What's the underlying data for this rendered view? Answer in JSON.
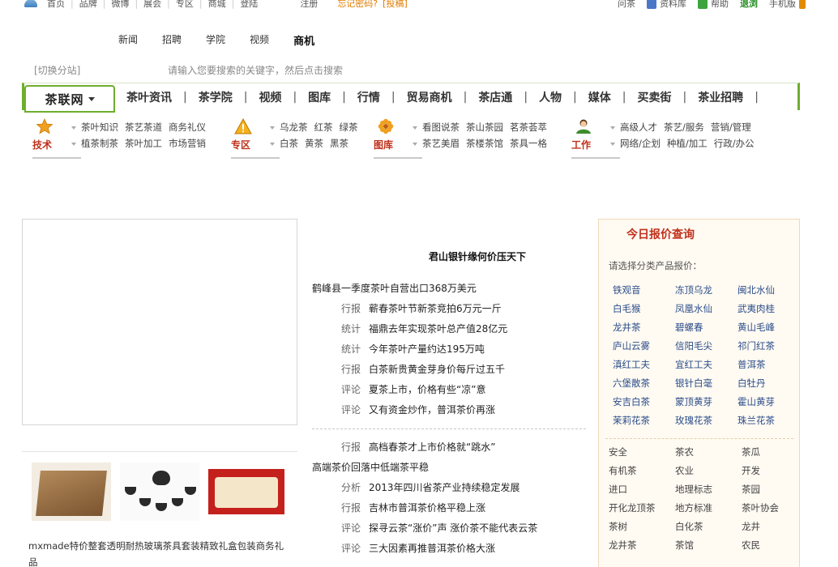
{
  "topbar": {
    "links": [
      "首页",
      "品牌",
      "微博",
      "展会",
      "专区",
      "商城",
      "登陆",
      "注册"
    ],
    "forgot": "忘记密码?",
    "submit": "[投稿]",
    "right": [
      "问茶",
      "资料库",
      "帮助",
      "退浏",
      "手机版"
    ]
  },
  "search": {
    "tabs": [
      "新闻",
      "招聘",
      "学院",
      "视频",
      "商机"
    ],
    "active_tab": "商机",
    "switch_site": "[切换分站]",
    "placeholder": "请输入您要搜索的关键字，然后点击搜索"
  },
  "mainnav": {
    "brand": "茶联网",
    "items": [
      "茶叶资讯",
      "茶学院",
      "视频",
      "图库",
      "行情",
      "贸易商机",
      "茶店通",
      "人物",
      "媒体",
      "买卖街",
      "茶业招聘"
    ]
  },
  "subnav": [
    {
      "label": "技术",
      "icon": "star-icon",
      "rows": [
        [
          "茶叶知识",
          "茶艺茶道",
          "商务礼仪"
        ],
        [
          "植茶制茶",
          "茶叶加工",
          "市场营销"
        ]
      ]
    },
    {
      "label": "专区",
      "icon": "warning-icon",
      "rows": [
        [
          "乌龙茶",
          "红茶",
          "绿茶"
        ],
        [
          "白茶",
          "黄茶",
          "黑茶"
        ]
      ]
    },
    {
      "label": "图库",
      "icon": "flower-icon",
      "rows": [
        [
          "看图说茶",
          "茶山茶园",
          "茗茶荟萃"
        ],
        [
          "茶艺美眉",
          "茶楼茶馆",
          "茶具一格"
        ]
      ]
    },
    {
      "label": "工作",
      "icon": "person-icon",
      "rows": [
        [
          "高级人才",
          "茶艺/服务",
          "营销/管理"
        ],
        [
          "网络/企划",
          "种植/加工",
          "行政/办公"
        ]
      ]
    }
  ],
  "center": {
    "headline": "君山银针缘何价压天下",
    "lead1": "鹤峰县一季度茶叶自营出口368万美元",
    "list1": [
      {
        "tag": "行报",
        "text": "蕲春茶叶节新茶竞拍6万元一斤"
      },
      {
        "tag": "统计",
        "text": "福鼎去年实现茶叶总产值28亿元"
      },
      {
        "tag": "统计",
        "text": "今年茶叶产量约达195万吨"
      },
      {
        "tag": "行报",
        "text": "白茶新贵黄金芽身价每斤过五千"
      },
      {
        "tag": "评论",
        "text": "夏茶上市，价格有些“凉”意"
      },
      {
        "tag": "评论",
        "text": "又有资金炒作，普洱茶价再涨"
      }
    ],
    "list2a": [
      {
        "tag": "行报",
        "text": "高档春茶才上市价格就“跳水”"
      }
    ],
    "lead2": "高端茶价回落中低端茶平稳",
    "list2b": [
      {
        "tag": "分析",
        "text": "2013年四川省茶产业持续稳定发展"
      },
      {
        "tag": "行报",
        "text": "吉林市普洱茶价格平稳上涨"
      },
      {
        "tag": "评论",
        "text": "探寻云茶“涨价”声 涨价茶不能代表云茶"
      },
      {
        "tag": "评论",
        "text": "三大因素再推普洱茶价格大涨"
      }
    ]
  },
  "product": {
    "title": "mxmade特价整套透明耐热玻璃茶具套装精致礼盒包装商务礼品"
  },
  "quote": {
    "title": "今日报价查询",
    "subtitle": "请选择分类产品报价：",
    "teas": [
      "铁观音",
      "冻顶乌龙",
      "闽北水仙",
      "白毛猴",
      "凤凰水仙",
      "武夷肉桂",
      "龙井茶",
      "碧螺春",
      "黄山毛峰",
      "庐山云雾",
      "信阳毛尖",
      "祁门红茶",
      "滇红工夫",
      "宜红工夫",
      "普洱茶",
      "六堡散茶",
      "银针白毫",
      "白牡丹",
      "安吉白茶",
      "蒙顶黄芽",
      "霍山黄芽",
      "茉莉花茶",
      "玫瑰花茶",
      "珠兰花茶"
    ],
    "tags": [
      "安全",
      "茶农",
      "茶瓜",
      "有机茶",
      "农业",
      "开发",
      "进口",
      "地理标志",
      "茶园",
      "开化龙顶茶",
      "地方标准",
      "茶叶协会",
      "茶树",
      "白化茶",
      "龙井",
      "龙井茶",
      "茶馆",
      "农民"
    ]
  }
}
